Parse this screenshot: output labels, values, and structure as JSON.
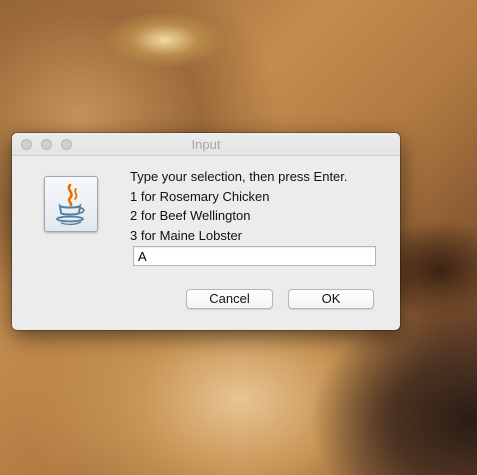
{
  "dialog": {
    "title": "Input",
    "icon": "java-coffee-cup-icon",
    "message_lines": [
      "Type your selection, then press Enter.",
      "1 for Rosemary Chicken",
      "2 for Beef Wellington",
      "3 for Maine Lobster"
    ],
    "input_value": "A",
    "cancel_label": "Cancel",
    "ok_label": "OK"
  },
  "colors": {
    "dialog_background": "#ececec",
    "title_text": "#a8a8a8",
    "traffic_lights_inactive": "#d0d0d0",
    "java_orange": "#e76f00",
    "java_blue": "#5382a1"
  }
}
